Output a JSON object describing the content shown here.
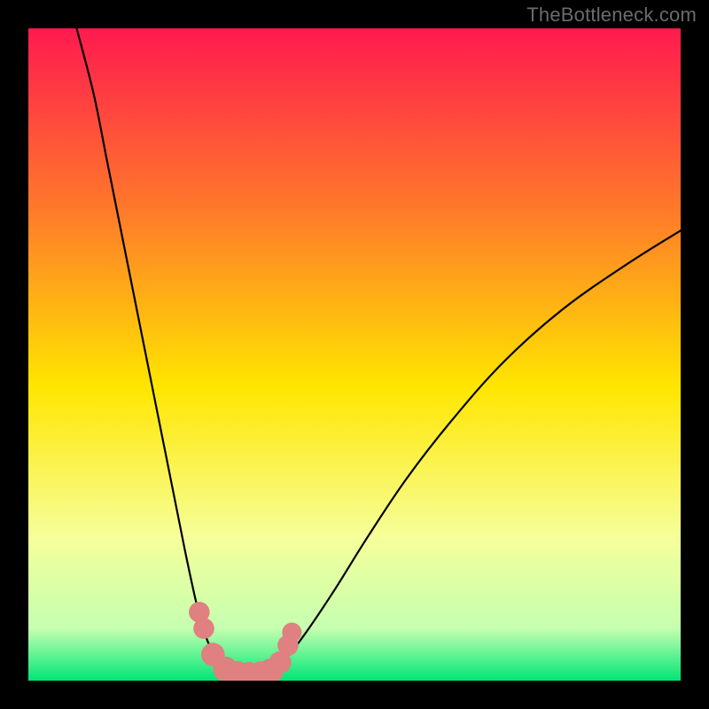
{
  "watermark": "TheBottleneck.com",
  "chart_data": {
    "type": "line",
    "title": "",
    "xlabel": "",
    "ylabel": "",
    "xlim": [
      0,
      100
    ],
    "ylim": [
      0,
      100
    ],
    "background_gradient": {
      "top": "#ff1a4f",
      "upper_mid": "#ff7a2a",
      "mid": "#ffe600",
      "lower_mid": "#f6ff9a",
      "near_bottom": "#c5ffb0",
      "bottom": "#00e676"
    },
    "curve_left": {
      "name": "left-arm",
      "x": [
        7.4,
        10,
        12,
        14,
        16,
        18,
        20,
        22,
        24,
        25.5,
        26.5,
        27.5,
        28.5,
        29.5,
        30.3,
        31.0
      ],
      "y": [
        100,
        90,
        80,
        70,
        60,
        50,
        40,
        30,
        20,
        13,
        9,
        6,
        4,
        2.5,
        1.6,
        1.2
      ]
    },
    "curve_floor": {
      "name": "valley-floor",
      "x": [
        31.0,
        32.0,
        33.0,
        34.0,
        35.0,
        36.0,
        37.0
      ],
      "y": [
        1.2,
        1.0,
        0.9,
        0.9,
        0.9,
        1.0,
        1.3
      ]
    },
    "curve_right": {
      "name": "right-arm",
      "x": [
        37.0,
        38.0,
        40,
        43,
        47,
        52,
        58,
        65,
        73,
        82,
        92,
        100
      ],
      "y": [
        1.3,
        2.0,
        4,
        8,
        14,
        22,
        31,
        40,
        49,
        57,
        64,
        69
      ]
    },
    "markers": {
      "name": "valley-markers",
      "color": "#e08080",
      "points": [
        {
          "x": 26.2,
          "y": 10.5,
          "r": 1.6
        },
        {
          "x": 26.9,
          "y": 8.0,
          "r": 1.6
        },
        {
          "x": 28.3,
          "y": 4.0,
          "r": 1.8
        },
        {
          "x": 30.2,
          "y": 1.8,
          "r": 1.9
        },
        {
          "x": 32.0,
          "y": 1.1,
          "r": 1.9
        },
        {
          "x": 33.8,
          "y": 0.95,
          "r": 1.9
        },
        {
          "x": 35.6,
          "y": 1.05,
          "r": 1.9
        },
        {
          "x": 37.2,
          "y": 1.5,
          "r": 1.9
        },
        {
          "x": 38.6,
          "y": 2.8,
          "r": 1.7
        },
        {
          "x": 39.8,
          "y": 5.4,
          "r": 1.6
        },
        {
          "x": 40.4,
          "y": 7.4,
          "r": 1.5
        }
      ]
    }
  }
}
